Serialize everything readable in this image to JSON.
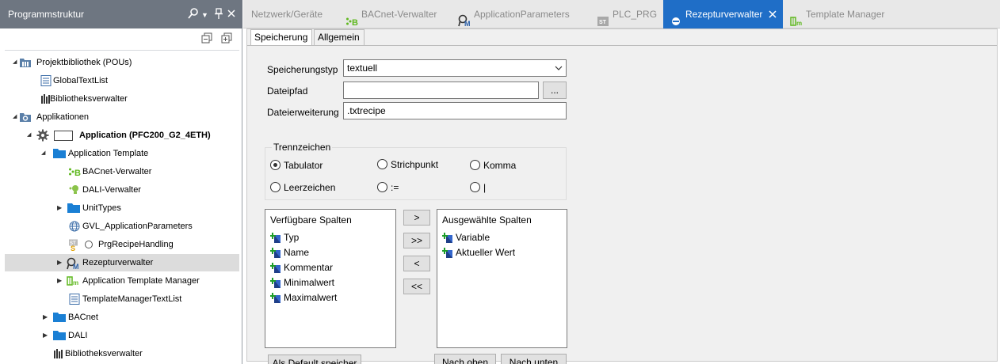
{
  "left_panel": {
    "title": "Programmstruktur",
    "tree": [
      {
        "label": "Projektbibliothek (POUs)",
        "icon": "library-folder-icon",
        "expanded": true
      },
      {
        "label": "GlobalTextList",
        "icon": "textlist-icon"
      },
      {
        "label": "Bibliotheksverwalter",
        "icon": "library-manager-icon"
      },
      {
        "label": "Applikationen",
        "icon": "applications-folder-icon",
        "expanded": true
      },
      {
        "label": "Application (PFC200_G2_4ETH)",
        "icon": "gear-icon",
        "expanded": true,
        "bold": true
      },
      {
        "label": "Application Template",
        "icon": "folder-icon",
        "expanded": true
      },
      {
        "label": "BACnet-Verwalter",
        "icon": "bacnet-icon"
      },
      {
        "label": "DALI-Verwalter",
        "icon": "dali-icon"
      },
      {
        "label": "UnitTypes",
        "icon": "folder-icon",
        "expanded": false
      },
      {
        "label": "GVL_ApplicationParameters",
        "icon": "globe-icon"
      },
      {
        "label": "PrgRecipeHandling",
        "icon": "st-program-icon"
      },
      {
        "label": "Rezepturverwalter",
        "icon": "recipe-manager-icon",
        "expanded": false,
        "selected": true
      },
      {
        "label": "Application Template Manager",
        "icon": "template-manager-icon",
        "expanded": false
      },
      {
        "label": "TemplateManagerTextList",
        "icon": "textlist-icon"
      },
      {
        "label": "BACnet",
        "icon": "folder-icon",
        "expanded": false
      },
      {
        "label": "DALI",
        "icon": "folder-icon",
        "expanded": false
      },
      {
        "label": "Bibliotheksverwalter",
        "icon": "library-manager-icon"
      }
    ]
  },
  "tabs": [
    {
      "label": "Netzwerk/Geräte",
      "icon": ""
    },
    {
      "label": "BACnet-Verwalter",
      "icon": "bacnet-icon"
    },
    {
      "label": "ApplicationParameters",
      "icon": "recipe-manager-icon"
    },
    {
      "label": "PLC_PRG",
      "icon": "st-icon"
    },
    {
      "label": "Rezepturverwalter",
      "icon": "recipe-manager-icon",
      "active": true
    },
    {
      "label": "Template Manager",
      "icon": "template-manager-icon"
    }
  ],
  "subtabs": [
    "Speicherung",
    "Allgemein"
  ],
  "form": {
    "speicherungstyp_label": "Speicherungstyp",
    "speicherungstyp_value": "textuell",
    "dateipfad_label": "Dateipfad",
    "dateipfad_value": "",
    "browse_label": "...",
    "dateierweiterung_label": "Dateierweiterung",
    "dateierweiterung_value": ".txtrecipe",
    "trennzeichen_title": "Trennzeichen",
    "separators": [
      {
        "label": "Tabulator",
        "selected": true
      },
      {
        "label": "Strichpunkt",
        "selected": false
      },
      {
        "label": "Komma",
        "selected": false
      },
      {
        "label": "Leerzeichen",
        "selected": false
      },
      {
        "label": ":=",
        "selected": false
      },
      {
        "label": "|",
        "selected": false
      }
    ],
    "available_title": "Verfügbare Spalten",
    "available": [
      "Typ",
      "Name",
      "Kommentar",
      "Minimalwert",
      "Maximalwert"
    ],
    "selected_title": "Ausgewählte Spalten",
    "selected": [
      "Variable",
      "Aktueller Wert"
    ],
    "move_buttons": [
      ">",
      ">>",
      "<",
      "<<"
    ],
    "default_button": "Als  Default speicher",
    "up_button": "Nach oben",
    "down_button": "Nach unten"
  },
  "colors": {
    "active_tab": "#1f6ec7",
    "panel_header": "#6e7681",
    "selection": "#dcdcdc"
  }
}
